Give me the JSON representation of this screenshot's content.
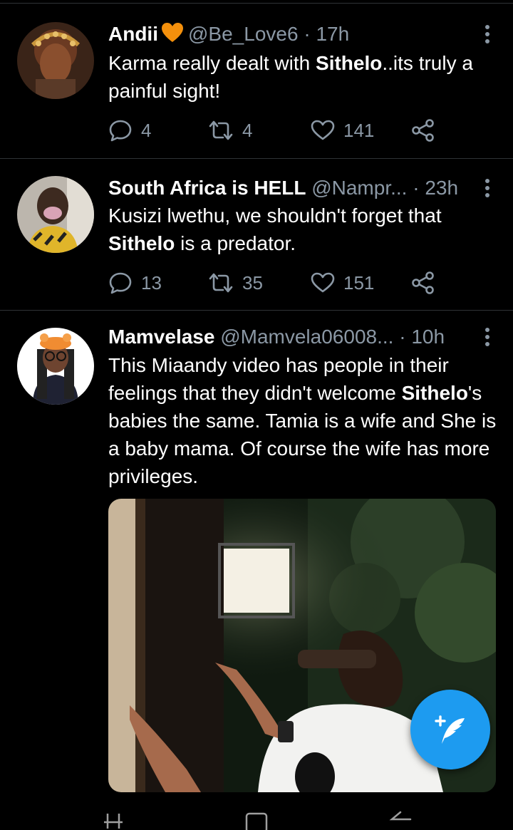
{
  "tweets": [
    {
      "name": "Andii",
      "badge": "orange-heart-emoji",
      "handle": "@Be_Love6",
      "sep": "·",
      "time": "17h",
      "text": [
        {
          "t": "Karma really dealt with ",
          "b": false
        },
        {
          "t": "Sithelo",
          "b": true
        },
        {
          "t": "..its truly a painful sight!",
          "b": false
        }
      ],
      "replies": "4",
      "retweets": "4",
      "likes": "141"
    },
    {
      "name": "South Africa is HELL",
      "handle": "@Nampr...",
      "sep": "·",
      "time": "23h",
      "text": [
        {
          "t": "Kusizi lwethu, we shouldn't forget that ",
          "b": false
        },
        {
          "t": "Sithelo",
          "b": true
        },
        {
          "t": " is a predator.",
          "b": false
        }
      ],
      "replies": "13",
      "retweets": "35",
      "likes": "151"
    },
    {
      "name": "Mamvelase",
      "handle": "@Mamvela06008...",
      "sep": "·",
      "time": "10h",
      "text": [
        {
          "t": "This Miaandy video has people in their feelings that they didn't welcome ",
          "b": false
        },
        {
          "t": "Sithelo",
          "b": true
        },
        {
          "t": "'s babies the same. Tamia is a wife and She is a baby mama. Of course the wife has more privileges.",
          "b": false
        }
      ]
    }
  ],
  "icons": {
    "reply": "reply-icon",
    "retweet": "retweet-icon",
    "like": "heart-icon",
    "share": "share-icon",
    "more": "more-vertical-icon",
    "compose": "compose-tweet-icon"
  },
  "colors": {
    "background": "#000000",
    "muted": "#8b98a5",
    "accent": "#1d9bf0",
    "divider": "#2f3336"
  }
}
